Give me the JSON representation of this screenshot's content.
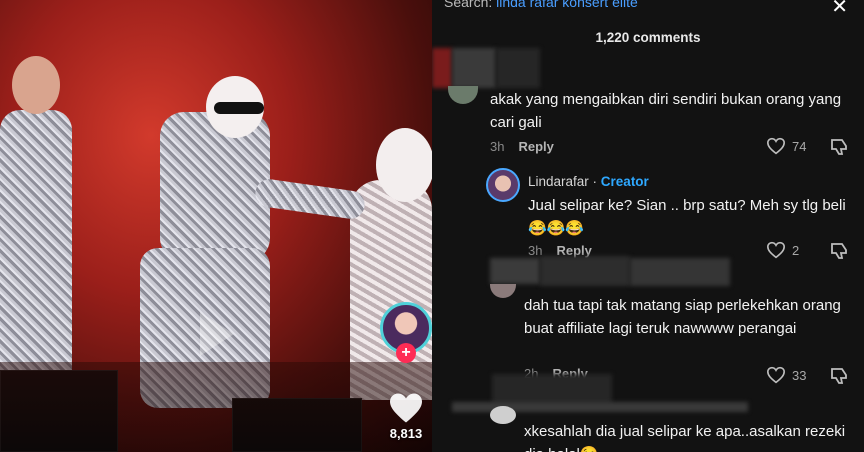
{
  "video": {
    "like_count": "8,813",
    "accent_color": "#fe2c55",
    "icons": [
      "heart-icon",
      "plus-icon",
      "play-icon"
    ]
  },
  "panel": {
    "search_prefix": "Search:",
    "search_query": "linda rafar konsert elite",
    "comment_count": "1,220 comments",
    "comments": [
      {
        "text": "akak yang mengaibkan diri sendiri bukan orang yang cari gali",
        "time": "3h",
        "reply": "Reply",
        "likes": "74"
      },
      {
        "user": "Lindarafar",
        "badge": "Creator",
        "text": "Jual selipar ke? Sian .. brp satu? Meh sy tlg beli 😂😂😂",
        "time": "3h",
        "reply": "Reply",
        "likes": "2"
      },
      {
        "text": "dah tua tapi tak matang siap perlekehkan orang buat affiliate lagi teruk nawwww perangai",
        "time": "2h",
        "reply": "Reply",
        "likes": "33"
      },
      {
        "text": "xkesahlah dia jual selipar ke apa..asalkan rezeki dia halal😉"
      }
    ]
  }
}
